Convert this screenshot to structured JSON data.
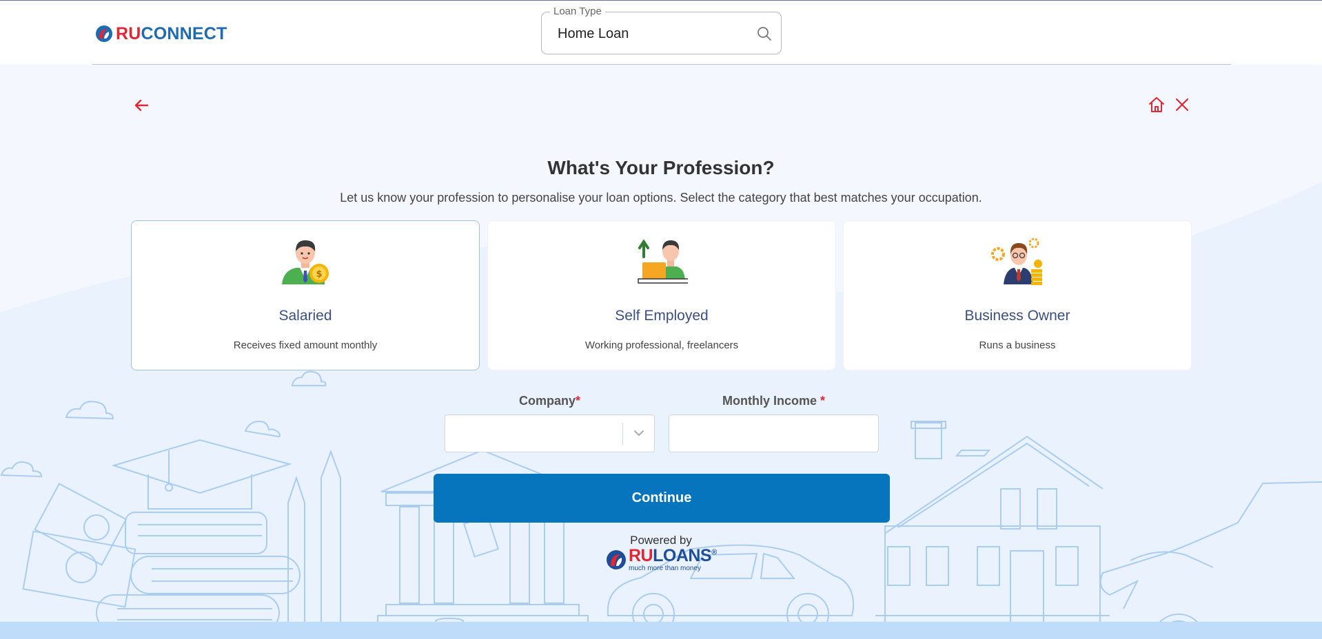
{
  "header": {
    "logo": {
      "ru": "RU",
      "connect": "CONNECT"
    },
    "loan_type": {
      "label": "Loan Type",
      "value": "Home Loan"
    }
  },
  "nav": {
    "back_icon": "arrow-left-icon",
    "home_icon": "home-icon",
    "close_icon": "close-icon",
    "icon_color": "#e22733"
  },
  "page": {
    "title": "What's Your Profession?",
    "subtitle": "Let us know your profession to personalise your loan options. Select the category that best matches your occupation."
  },
  "professions": [
    {
      "name": "Salaried",
      "description": "Receives fixed amount monthly",
      "selected": true,
      "icon": "salaried-person-icon"
    },
    {
      "name": "Self Employed",
      "description": "Working professional, freelancers",
      "selected": false,
      "icon": "self-employed-laptop-icon"
    },
    {
      "name": "Business Owner",
      "description": "Runs a business",
      "selected": false,
      "icon": "business-owner-coins-icon"
    }
  ],
  "form": {
    "company": {
      "label": "Company",
      "required_mark": "*",
      "value": ""
    },
    "monthly_income": {
      "label": "Monthly Income ",
      "required_mark": "*",
      "value": ""
    },
    "continue_label": "Continue"
  },
  "footer": {
    "powered_by": "Powered by",
    "brand": {
      "ru": "RU",
      "loans": "LOANS",
      "registered": "®",
      "tagline": "much more than money"
    }
  },
  "colors": {
    "primary": "#0675be",
    "accent_red": "#e22733",
    "brand_blue": "#1e6bb4",
    "background": "#f4f7fd",
    "illustration_line": "#a9cdf2"
  }
}
